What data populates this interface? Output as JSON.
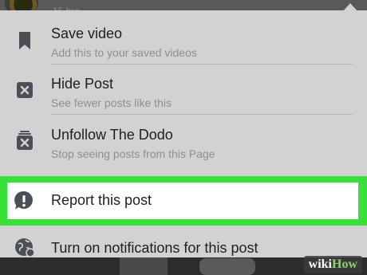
{
  "background": {
    "timestamp": "15 hrs"
  },
  "menu": {
    "items": [
      {
        "title": "Save video",
        "subtitle": "Add this to your saved videos",
        "icon": "bookmark-icon"
      },
      {
        "title": "Hide Post",
        "subtitle": "See fewer posts like this",
        "icon": "hide-x-icon"
      },
      {
        "title": "Unfollow The Dodo",
        "subtitle": "Stop seeing posts from this Page",
        "icon": "unfollow-icon"
      },
      {
        "title": "Report this post",
        "icon": "report-exclamation-icon",
        "highlighted": true,
        "highlight_color": "#39e039"
      },
      {
        "title": "Turn on notifications for this post",
        "icon": "globe-notification-icon"
      }
    ]
  },
  "watermark": {
    "part1": "wiki",
    "part2": "How"
  },
  "colors": {
    "menu_bg": "#d2d2d2",
    "icon": "#4b4f56",
    "highlight": "#39e039"
  }
}
